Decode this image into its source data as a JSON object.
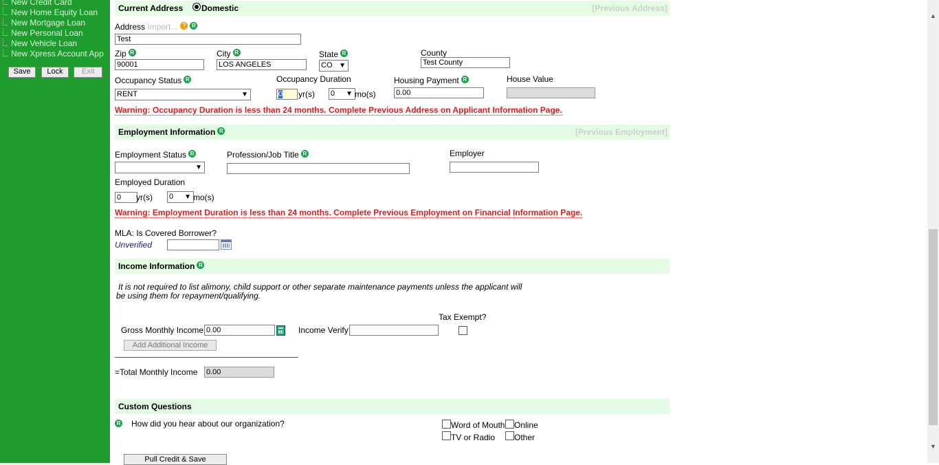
{
  "sidebar": {
    "items": [
      {
        "label": "New Credit Card"
      },
      {
        "label": "New Home Equity Loan"
      },
      {
        "label": "New Mortgage Loan"
      },
      {
        "label": "New Personal Loan"
      },
      {
        "label": "New Vehicle Loan"
      },
      {
        "label": "New Xpress Account App"
      }
    ],
    "buttons": {
      "save": "Save",
      "lock": "Lock",
      "exit": "Exit"
    }
  },
  "address": {
    "section_title": "Current Address",
    "radio_label": "Domestic",
    "previous_link": "[Previous Address]",
    "address_label": "Address",
    "import_link": "Import...",
    "address_value": "Test",
    "zip_label": "Zip",
    "zip_value": "90001",
    "city_label": "City",
    "city_value": "LOS ANGELES",
    "state_label": "State",
    "state_value": "CO",
    "county_label": "County",
    "county_value": "Test County",
    "occupancy_status_label": "Occupancy Status",
    "occupancy_status_value": "RENT",
    "occupancy_duration_label": "Occupancy Duration",
    "occ_years_value": "0",
    "yrs_unit": "yr(s)",
    "occ_months_value": "0",
    "mos_unit": "mo(s)",
    "housing_payment_label": "Housing Payment",
    "housing_payment_value": "0.00",
    "house_value_label": "House Value",
    "warning": "Warning: Occupancy Duration is less than 24 months. Complete Previous Address on Applicant Information Page."
  },
  "employment": {
    "section_title": "Employment Information",
    "previous_link": "[Previous Employment]",
    "status_label": "Employment Status",
    "profession_label": "Profession/Job Title",
    "employer_label": "Employer",
    "duration_label": "Employed Duration",
    "years_value": "0",
    "yrs_unit": "yr(s)",
    "months_value": "0",
    "mos_unit": "mo(s)",
    "warning": "Warning: Employment Duration is less than 24 months. Complete Previous Employment on Financial Information Page.",
    "mla_label": "MLA: Is Covered Borrower?",
    "mla_status": "Unverified"
  },
  "income": {
    "section_title": "Income Information",
    "note_line1": "It is not required to list alimony, child support or other separate maintenance payments unless the applicant will",
    "note_line2": "be using them for repayment/qualifying.",
    "tax_exempt_label": "Tax Exempt?",
    "gross_label": "Gross Monthly Income",
    "gross_value": "0.00",
    "verify_label": "Income Verify",
    "add_button": "Add Additional Income",
    "total_label": "=Total Monthly Income",
    "total_value": "0.00"
  },
  "custom": {
    "section_title": "Custom Questions",
    "question": "How did you hear about our organization?",
    "options": [
      "Word of Mouth",
      "Online",
      "TV or Radio",
      "Other"
    ]
  },
  "footer": {
    "pull_credit_button": "Pull Credit & Save"
  },
  "icons": {
    "required": "R",
    "help": "?"
  },
  "colors": {
    "sidebar": "#1f9c2e",
    "band": "#e4fbe4",
    "warning": "#e01b1b",
    "required": "#16a34a"
  }
}
